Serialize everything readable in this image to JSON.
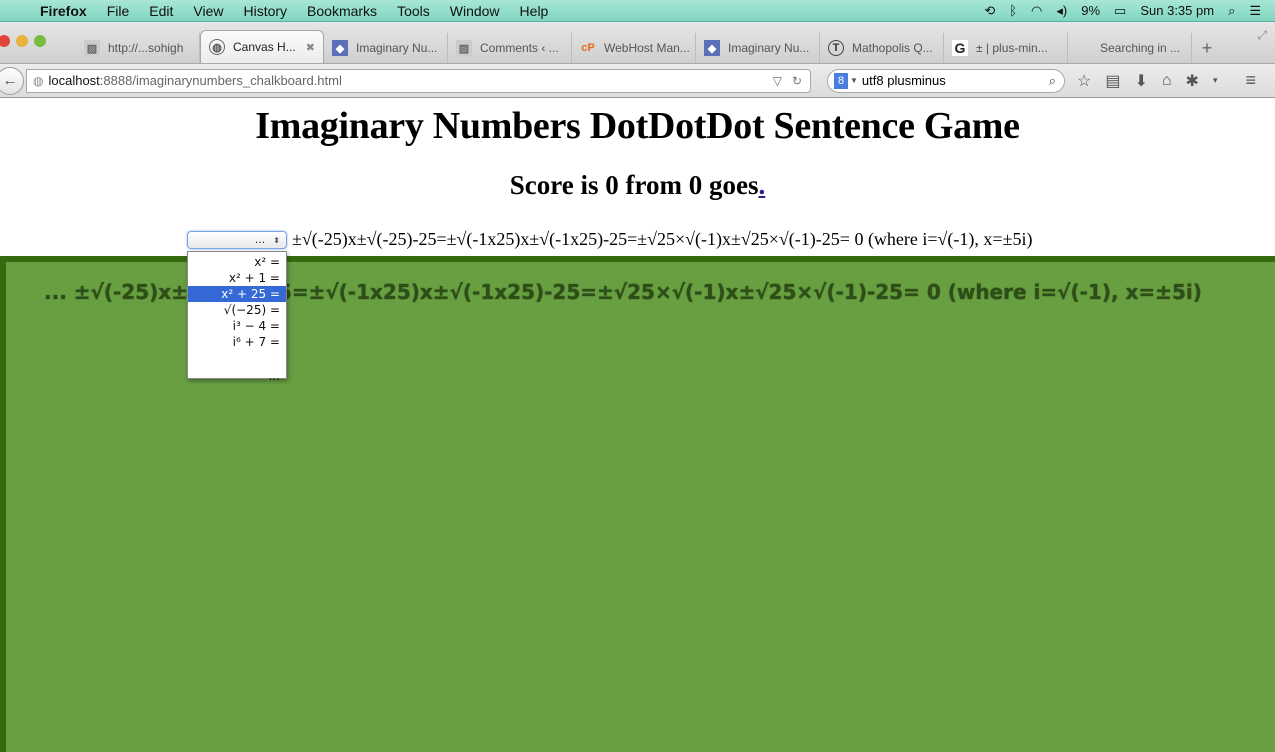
{
  "menubar": {
    "app_name": "Firefox",
    "items": [
      "File",
      "Edit",
      "View",
      "History",
      "Bookmarks",
      "Tools",
      "Window",
      "Help"
    ],
    "battery": "9%",
    "clock": "Sun 3:35 pm"
  },
  "tabs": [
    {
      "label": "http://...sohigh",
      "favicon": "page-icon",
      "active": false
    },
    {
      "label": "Canvas H...",
      "favicon": "globe-icon",
      "active": true
    },
    {
      "label": "Imaginary Nu...",
      "favicon": "site-icon",
      "active": false
    },
    {
      "label": "Comments ‹ ...",
      "favicon": "page-icon",
      "active": false
    },
    {
      "label": "WebHost Man...",
      "favicon": "cpanel-icon",
      "active": false
    },
    {
      "label": "Imaginary Nu...",
      "favicon": "site-icon",
      "active": false
    },
    {
      "label": "Mathopolis Q...",
      "favicon": "mathopolis-icon",
      "active": false
    },
    {
      "label": "± | plus-min...",
      "favicon": "google-icon",
      "active": false
    },
    {
      "label": "Searching in ...",
      "favicon": "",
      "active": false
    }
  ],
  "navbar": {
    "url_host": "localhost",
    "url_path": ":8888/imaginarynumbers_chalkboard.html",
    "search_value": "utf8 plusminus",
    "search_engine_badge": "8"
  },
  "page": {
    "title": "Imaginary Numbers DotDotDot Sentence Game",
    "score_text": "Score is 0 from 0 goes",
    "score_link": ".",
    "select_value": "...",
    "sentence": "±√(-25)x±√(-25)-25=±√(-1x25)x±√(-1x25)-25=±√25×√(-1)x±√25×√(-1)-25= 0 (where i=√(-1), x=±5i)",
    "canvas_text": "... ±√(-25)x±√(-25)-25=±√(-1x25)x±√(-1x25)-25=±√25×√(-1)x±√25×√(-1)-25= 0 (where i=√(-1), x=±5i)",
    "dropdown_options": [
      {
        "label": "x² =",
        "selected": false
      },
      {
        "label": "x² + 1 =",
        "selected": false
      },
      {
        "label": "x² + 25 =",
        "selected": true
      },
      {
        "label": "√(−25) =",
        "selected": false
      },
      {
        "label": "i³ − 4 =",
        "selected": false
      },
      {
        "label": "i⁶ + 7 =",
        "selected": false
      },
      {
        "label": "",
        "selected": false
      },
      {
        "label": "...",
        "selected": false
      }
    ]
  },
  "colors": {
    "canvas_bg": "#679f41",
    "canvas_border": "#336b0e",
    "canvas_text": "#2e4d18",
    "selected_option": "#3469d6"
  }
}
